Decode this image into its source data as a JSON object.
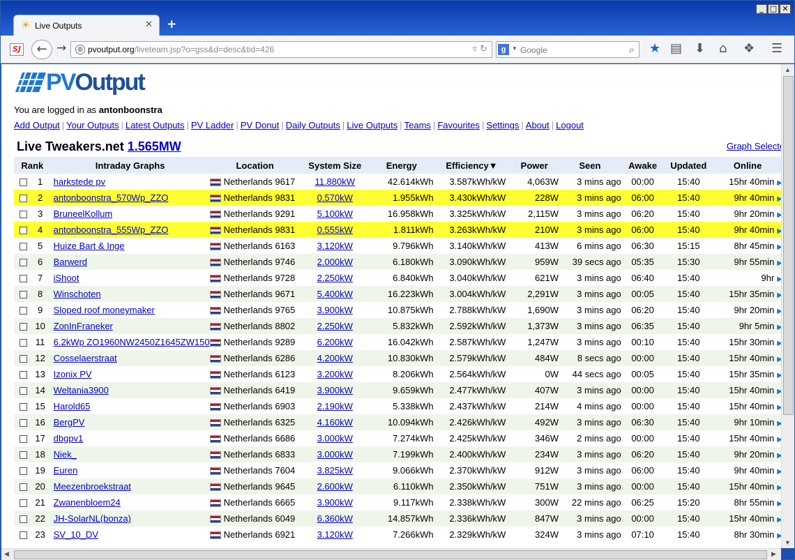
{
  "browser": {
    "tab_title": "Live Outputs",
    "new_tab": "+",
    "url_domain": "pvoutput.org",
    "url_path": "/liveteam.jsp?o=gss&d=desc&tid=426",
    "search_engine": "g",
    "search_placeholder": "Google",
    "window_min": "_",
    "window_max": "□",
    "window_close": "✕"
  },
  "page": {
    "logo_pv": "PV",
    "logo_output": "Output",
    "logged_in_prefix": "You are logged in as",
    "username": "antonboonstra",
    "nav": [
      "Add Output",
      "Your Outputs",
      "Latest Outputs",
      "PV Ladder",
      "PV Donut",
      "Daily Outputs",
      "Live Outputs",
      "Teams",
      "Favourites",
      "Settings",
      "About",
      "Logout"
    ],
    "team_title": "Live Tweakers.net",
    "team_total": "1.565MW",
    "graph_selected": "Graph Selecte"
  },
  "table": {
    "headers": [
      "Rank",
      "Intraday Graphs",
      "Location",
      "System Size",
      "Energy",
      "Efficiency▼",
      "Power",
      "Seen",
      "Awake",
      "Updated",
      "Online"
    ],
    "rows": [
      {
        "rank": "1",
        "name": "harkstede pv",
        "loc": "Netherlands 9617",
        "size": "11.880kW",
        "energy": "42.614kWh",
        "eff": "3.587kWh/kW",
        "power": "4,063W",
        "seen": "3 mins ago",
        "awake": "00:00",
        "updated": "15:40",
        "online": "15hr 40min"
      },
      {
        "rank": "2",
        "name": "antonboonstra_570Wp_ZZO",
        "loc": "Netherlands 9831",
        "size": "0.570kW",
        "energy": "1.955kWh",
        "eff": "3.430kWh/kW",
        "power": "228W",
        "seen": "3 mins ago",
        "awake": "06:00",
        "updated": "15:40",
        "online": "9hr 40min"
      },
      {
        "rank": "3",
        "name": "BruneelKollum",
        "loc": "Netherlands 9291",
        "size": "5.100kW",
        "energy": "16.958kWh",
        "eff": "3.325kWh/kW",
        "power": "2,115W",
        "seen": "3 mins ago",
        "awake": "06:20",
        "updated": "15:40",
        "online": "9hr 20min"
      },
      {
        "rank": "4",
        "name": "antonboonstra_555Wp_ZZO",
        "loc": "Netherlands 9831",
        "size": "0.555kW",
        "energy": "1.811kWh",
        "eff": "3.263kWh/kW",
        "power": "210W",
        "seen": "3 mins ago",
        "awake": "06:00",
        "updated": "15:40",
        "online": "9hr 40min"
      },
      {
        "rank": "5",
        "name": "Huize Bart & Inge",
        "loc": "Netherlands 6163",
        "size": "3.120kW",
        "energy": "9.796kWh",
        "eff": "3.140kWh/kW",
        "power": "413W",
        "seen": "6 mins ago",
        "awake": "06:30",
        "updated": "15:15",
        "online": "8hr 45min"
      },
      {
        "rank": "6",
        "name": "Barwerd",
        "loc": "Netherlands 9746",
        "size": "2.000kW",
        "energy": "6.180kWh",
        "eff": "3.090kWh/kW",
        "power": "959W",
        "seen": "39 secs ago",
        "awake": "05:35",
        "updated": "15:30",
        "online": "9hr 55min"
      },
      {
        "rank": "7",
        "name": "iShoot",
        "loc": "Netherlands 9728",
        "size": "2.250kW",
        "energy": "6.840kWh",
        "eff": "3.040kWh/kW",
        "power": "621W",
        "seen": "3 mins ago",
        "awake": "06:40",
        "updated": "15:40",
        "online": "9hr"
      },
      {
        "rank": "8",
        "name": "Winschoten",
        "loc": "Netherlands 9671",
        "size": "5.400kW",
        "energy": "16.223kWh",
        "eff": "3.004kWh/kW",
        "power": "2,291W",
        "seen": "3 mins ago",
        "awake": "00:05",
        "updated": "15:40",
        "online": "15hr 35min"
      },
      {
        "rank": "9",
        "name": "Sloped roof moneymaker",
        "loc": "Netherlands 9765",
        "size": "3.900kW",
        "energy": "10.875kWh",
        "eff": "2.788kWh/kW",
        "power": "1,690W",
        "seen": "3 mins ago",
        "awake": "06:20",
        "updated": "15:40",
        "online": "9hr 20min"
      },
      {
        "rank": "10",
        "name": "ZonInFraneker",
        "loc": "Netherlands 8802",
        "size": "2.250kW",
        "energy": "5.832kWh",
        "eff": "2.592kWh/kW",
        "power": "1,373W",
        "seen": "3 mins ago",
        "awake": "06:35",
        "updated": "15:40",
        "online": "9hr 5min"
      },
      {
        "rank": "11",
        "name": "6.2kWp ZO1960NW2450Z1645ZW150",
        "loc": "Netherlands 9289",
        "size": "6.200kW",
        "energy": "16.042kWh",
        "eff": "2.587kWh/kW",
        "power": "1,247W",
        "seen": "3 mins ago",
        "awake": "00:10",
        "updated": "15:40",
        "online": "15hr 30min"
      },
      {
        "rank": "12",
        "name": "Cosselaerstraat",
        "loc": "Netherlands 6286",
        "size": "4.200kW",
        "energy": "10.830kWh",
        "eff": "2.579kWh/kW",
        "power": "484W",
        "seen": "8 secs ago",
        "awake": "00:00",
        "updated": "15:40",
        "online": "15hr 40min"
      },
      {
        "rank": "13",
        "name": "Izonix PV",
        "loc": "Netherlands 6123",
        "size": "3.200kW",
        "energy": "8.206kWh",
        "eff": "2.564kWh/kW",
        "power": "0W",
        "seen": "44 secs ago",
        "awake": "00:05",
        "updated": "15:40",
        "online": "15hr 35min"
      },
      {
        "rank": "14",
        "name": "Weltania3900",
        "loc": "Netherlands 6419",
        "size": "3.900kW",
        "energy": "9.659kWh",
        "eff": "2.477kWh/kW",
        "power": "407W",
        "seen": "3 mins ago",
        "awake": "00:00",
        "updated": "15:40",
        "online": "15hr 40min"
      },
      {
        "rank": "15",
        "name": "Harold65",
        "loc": "Netherlands 6903",
        "size": "2.190kW",
        "energy": "5.338kWh",
        "eff": "2.437kWh/kW",
        "power": "214W",
        "seen": "4 mins ago",
        "awake": "00:00",
        "updated": "15:40",
        "online": "15hr 40min"
      },
      {
        "rank": "16",
        "name": "BergPV",
        "loc": "Netherlands 6325",
        "size": "4.160kW",
        "energy": "10.094kWh",
        "eff": "2.426kWh/kW",
        "power": "492W",
        "seen": "3 mins ago",
        "awake": "06:30",
        "updated": "15:40",
        "online": "9hr 10min"
      },
      {
        "rank": "17",
        "name": "dbgpv1",
        "loc": "Netherlands 6686",
        "size": "3.000kW",
        "energy": "7.274kWh",
        "eff": "2.425kWh/kW",
        "power": "346W",
        "seen": "2 mins ago",
        "awake": "00:00",
        "updated": "15:40",
        "online": "15hr 40min"
      },
      {
        "rank": "18",
        "name": "Niek_",
        "loc": "Netherlands 6833",
        "size": "3.000kW",
        "energy": "7.199kWh",
        "eff": "2.400kWh/kW",
        "power": "234W",
        "seen": "3 mins ago",
        "awake": "06:20",
        "updated": "15:40",
        "online": "9hr 20min"
      },
      {
        "rank": "19",
        "name": "Euren",
        "loc": "Netherlands 7604",
        "size": "3.825kW",
        "energy": "9.066kWh",
        "eff": "2.370kWh/kW",
        "power": "912W",
        "seen": "3 mins ago",
        "awake": "06:00",
        "updated": "15:40",
        "online": "9hr 40min"
      },
      {
        "rank": "20",
        "name": "Meezenbroekstraat",
        "loc": "Netherlands 9645",
        "size": "2.600kW",
        "energy": "6.110kWh",
        "eff": "2.350kWh/kW",
        "power": "751W",
        "seen": "3 mins ago",
        "awake": "00:00",
        "updated": "15:40",
        "online": "15hr 40min"
      },
      {
        "rank": "21",
        "name": "Zwanenbloem24",
        "loc": "Netherlands 6665",
        "size": "3.900kW",
        "energy": "9.117kWh",
        "eff": "2.338kWh/kW",
        "power": "300W",
        "seen": "22 mins ago",
        "awake": "06:25",
        "updated": "15:20",
        "online": "8hr 55min"
      },
      {
        "rank": "22",
        "name": "JH-SolarNL(bonza)",
        "loc": "Netherlands 6049",
        "size": "6.360kW",
        "energy": "14.857kWh",
        "eff": "2.336kWh/kW",
        "power": "847W",
        "seen": "3 mins ago",
        "awake": "00:00",
        "updated": "15:40",
        "online": "15hr 40min"
      },
      {
        "rank": "23",
        "name": "SV_10_DV",
        "loc": "Netherlands 6921",
        "size": "3.120kW",
        "energy": "7.266kWh",
        "eff": "2.329kWh/kW",
        "power": "324W",
        "seen": "3 mins ago",
        "awake": "07:10",
        "updated": "15:40",
        "online": "8hr 30min"
      }
    ],
    "highlight_ranks": [
      "2",
      "4"
    ]
  }
}
